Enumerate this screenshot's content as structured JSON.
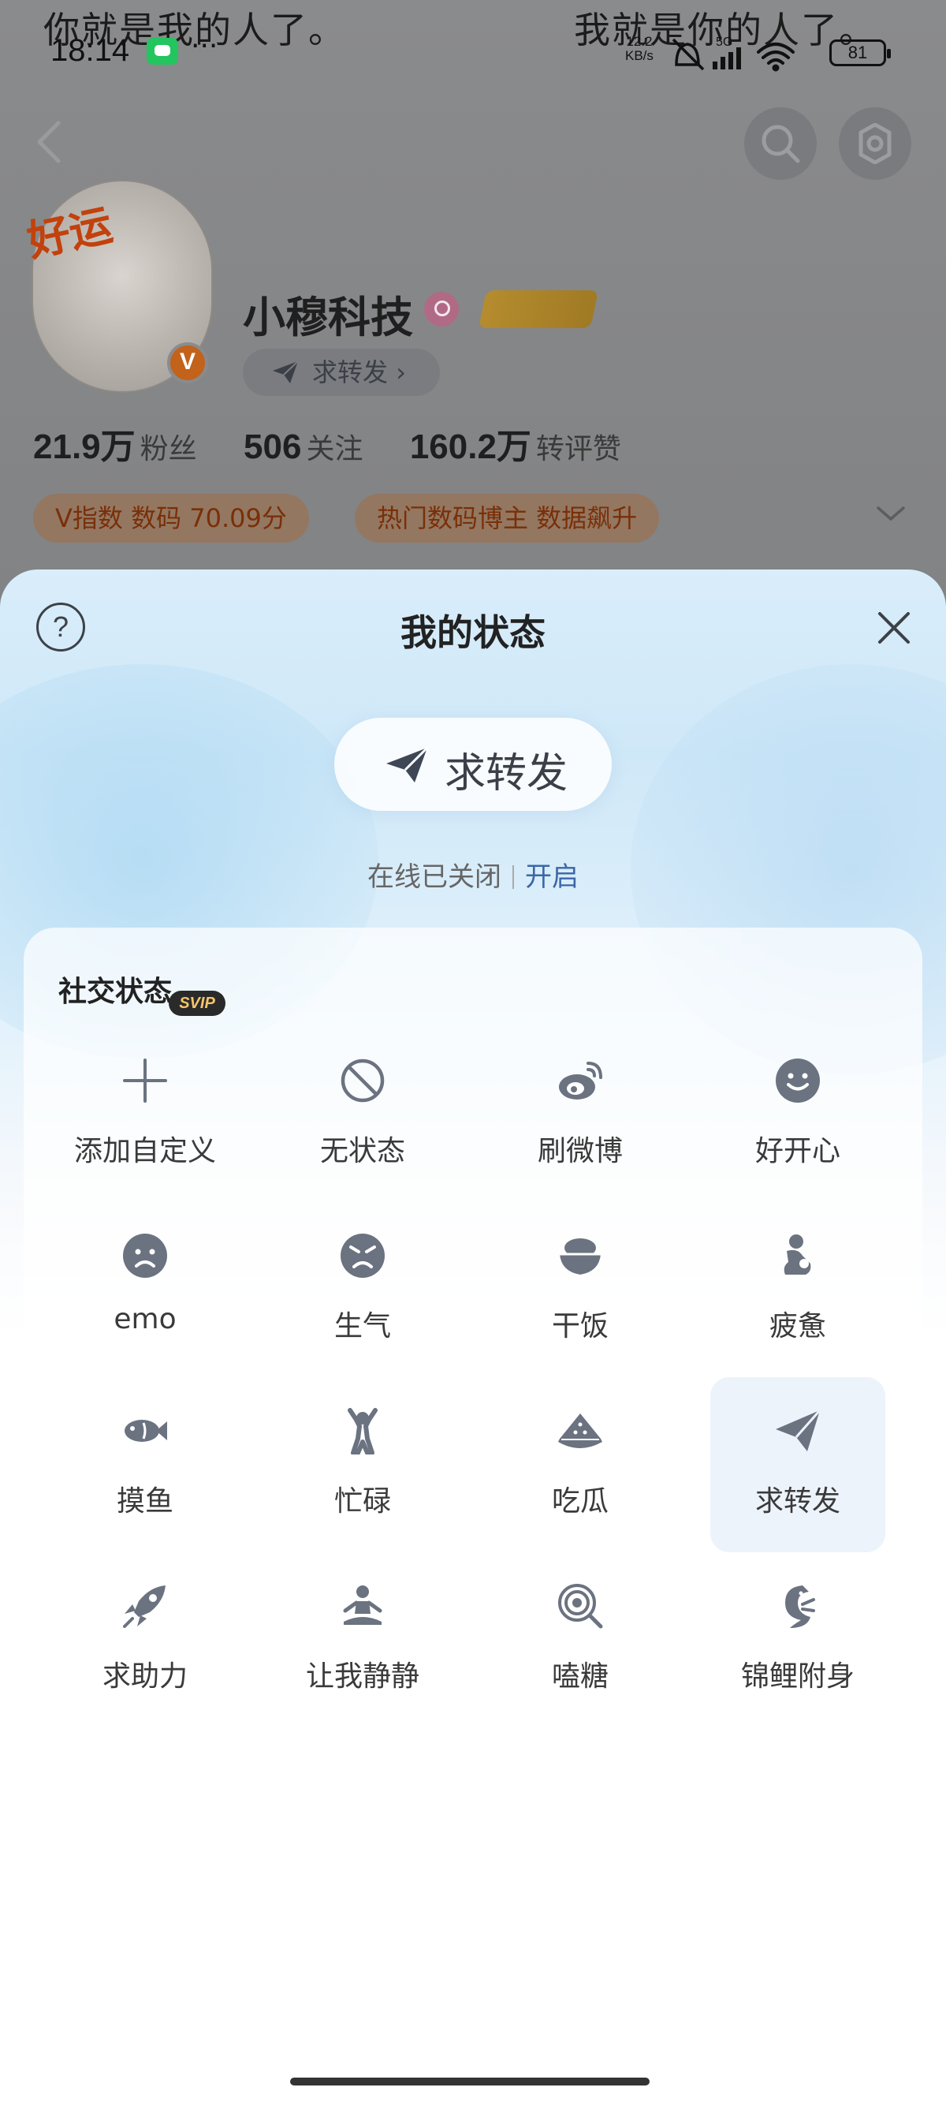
{
  "overlay": {
    "lyric_left": "你就是我的人了。",
    "lyric_right": "我就是你的人了。"
  },
  "status_bar": {
    "time": "18:14",
    "more": "···",
    "net_speed_value": "12.2",
    "net_speed_unit": "KB/s",
    "network": "5G",
    "battery": "81"
  },
  "profile": {
    "avatar_badge": "好运",
    "verified_badge": "V",
    "username": "小穆科技",
    "status_pill": "求转发",
    "stats": [
      {
        "value": "21.9万",
        "label": "粉丝"
      },
      {
        "value": "506",
        "label": "关注"
      },
      {
        "value": "160.2万",
        "label": "转评赞"
      }
    ],
    "tags": [
      "V指数 数码 70.09分",
      "热门数码博主 数据飙升"
    ]
  },
  "sheet": {
    "title": "我的状态",
    "help": "?",
    "current_status": "求转发",
    "online_text": "在线已关闭",
    "online_action": "开启",
    "section_title": "社交状态",
    "svip_badge": "SVIP",
    "items": [
      {
        "label": "添加自定义",
        "icon": "plus-icon"
      },
      {
        "label": "无状态",
        "icon": "prohibited-icon"
      },
      {
        "label": "刷微博",
        "icon": "weibo-icon"
      },
      {
        "label": "好开心",
        "icon": "happy-face-icon"
      },
      {
        "label": "emo",
        "icon": "sad-face-icon"
      },
      {
        "label": "生气",
        "icon": "angry-face-icon"
      },
      {
        "label": "干饭",
        "icon": "rice-bowl-icon"
      },
      {
        "label": "疲惫",
        "icon": "tired-person-icon"
      },
      {
        "label": "摸鱼",
        "icon": "fish-icon"
      },
      {
        "label": "忙碌",
        "icon": "busy-person-icon"
      },
      {
        "label": "吃瓜",
        "icon": "watermelon-icon"
      },
      {
        "label": "求转发",
        "icon": "paper-plane-icon"
      },
      {
        "label": "求助力",
        "icon": "rocket-icon"
      },
      {
        "label": "让我静静",
        "icon": "meditate-icon"
      },
      {
        "label": "嗑糖",
        "icon": "lollipop-icon"
      },
      {
        "label": "锦鲤附身",
        "icon": "koi-icon"
      }
    ],
    "selected": "求转发"
  },
  "colors": {
    "accent_blue": "#3b67a6",
    "icon_gray": "#6b7280",
    "tag_text": "#7a2f08"
  }
}
